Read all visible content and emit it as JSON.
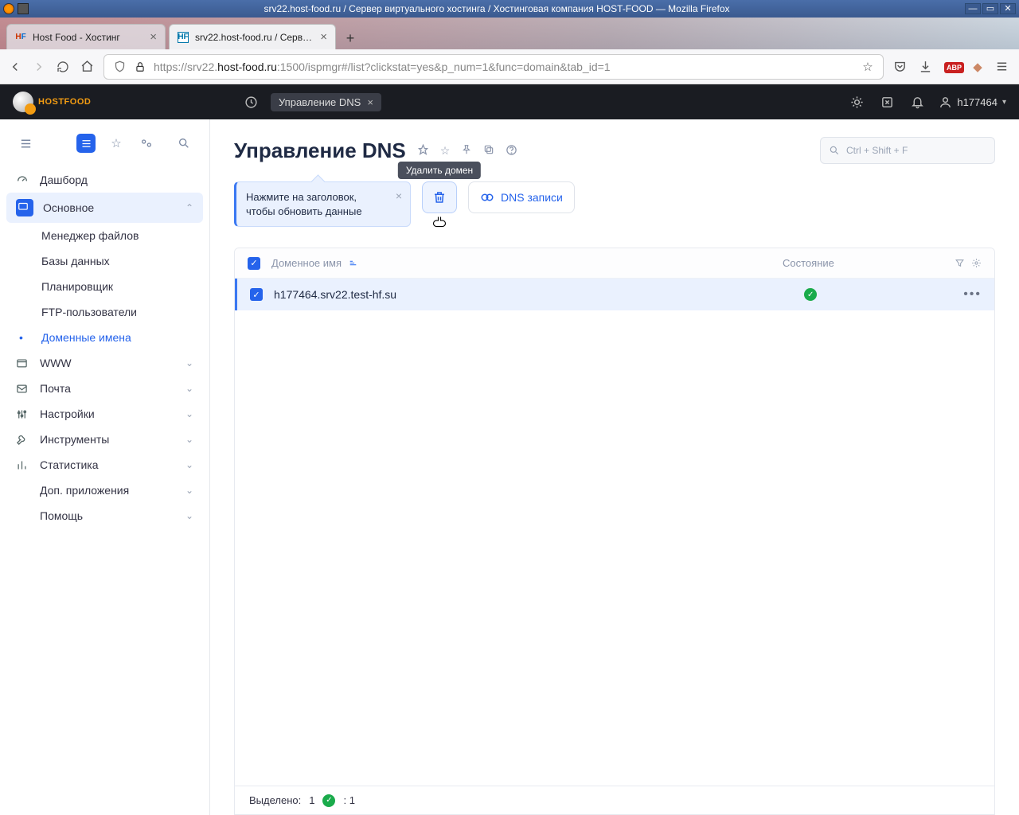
{
  "os": {
    "title": "srv22.host-food.ru / Сервер виртуального хостинга / Хостинговая компания HOST-FOOD — Mozilla Firefox"
  },
  "browser": {
    "tabs": [
      {
        "label": "Host Food - Хостинг",
        "favicon": "HF"
      },
      {
        "label": "srv22.host-food.ru / Сервер…",
        "favicon": "HF"
      }
    ],
    "url_pre": "https://srv22.",
    "url_bold": "host-food.ru",
    "url_post": ":1500/ispmgr#/list?clickstat=yes&p_num=1&func=domain&tab_id=1"
  },
  "header": {
    "logo_text": "HOSTFOOD",
    "active_tab": "Управление DNS",
    "user": "h177464"
  },
  "sidebar": {
    "dashboard": "Дашборд",
    "main_group": "Основное",
    "items_main": [
      "Менеджер файлов",
      "Базы данных",
      "Планировщик",
      "FTP-пользователи",
      "Доменные имена"
    ],
    "groups_rest": [
      "WWW",
      "Почта",
      "Настройки",
      "Инструменты",
      "Статистика",
      "Доп. приложения",
      "Помощь"
    ]
  },
  "page": {
    "title": "Управление DNS",
    "hint": "Нажмите на заголовок, чтобы обновить данные",
    "tooltip": "Удалить домен",
    "dns_records": "DNS записи",
    "search_placeholder": "Ctrl + Shift + F"
  },
  "table": {
    "col_name": "Доменное имя",
    "col_state": "Состояние",
    "rows": [
      {
        "name": "h177464.srv22.test-hf.su",
        "state": "ok"
      }
    ],
    "footer_selected_label": "Выделено:",
    "footer_selected_count": 1,
    "footer_total": 1
  }
}
